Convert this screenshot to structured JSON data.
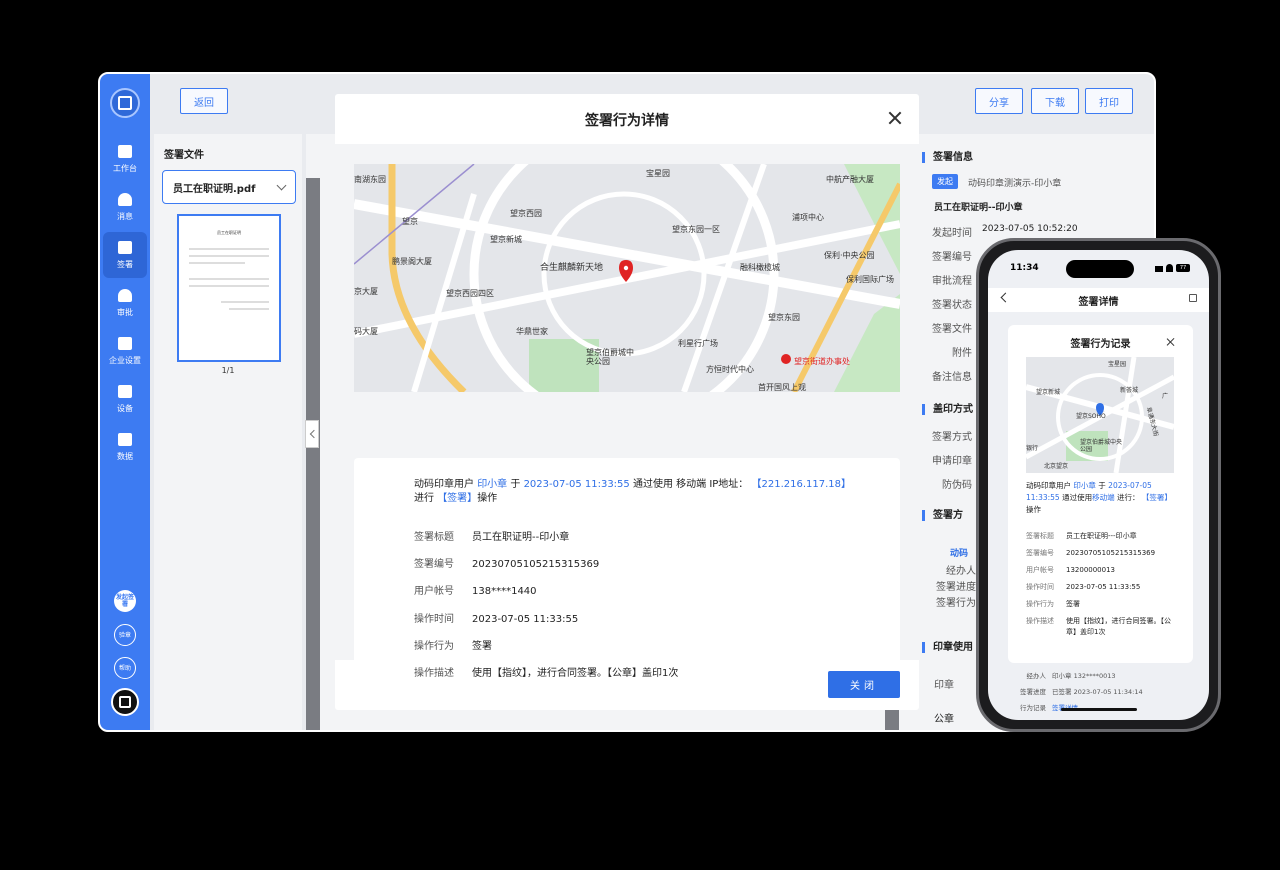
{
  "sidebar": {
    "items": [
      {
        "label": "工作台"
      },
      {
        "label": "消息"
      },
      {
        "label": "签署"
      },
      {
        "label": "审批"
      },
      {
        "label": "企业设置"
      },
      {
        "label": "设备"
      },
      {
        "label": "数据"
      }
    ],
    "bottom": [
      {
        "label": "发起签署"
      },
      {
        "label": "验章"
      },
      {
        "label": "帮助"
      }
    ]
  },
  "toolbar": {
    "back": "返回",
    "share": "分享",
    "download": "下载",
    "print": "打印"
  },
  "left_panel": {
    "title": "签署文件",
    "file_select": "员工在职证明.pdf",
    "page": "1/1",
    "thumb_title": "员工在职证明"
  },
  "right_panel": {
    "section_sign_info": "签署信息",
    "tag_initiate": "发起",
    "initiator_line": "动码印章测演示-印小章",
    "doc_title": "员工在职证明--印小章",
    "rows": [
      {
        "label": "发起时间",
        "value": "2023-07-05 10:52:20"
      },
      {
        "label": "签署编号",
        "value": ""
      },
      {
        "label": "审批流程",
        "value": ""
      },
      {
        "label": "签署状态",
        "value": ""
      },
      {
        "label": "签署文件",
        "value": ""
      },
      {
        "label": "附件",
        "value": ""
      },
      {
        "label": "备注信息",
        "value": ""
      }
    ],
    "section_seal_method": "盖印方式",
    "seal_rows": [
      {
        "label": "签署方式"
      },
      {
        "label": "申请印章"
      },
      {
        "label": "防伪码"
      }
    ],
    "section_signer": "签署方",
    "signer_name": "动码",
    "signer_rows": [
      {
        "label": "经办人"
      },
      {
        "label": "签署进度"
      },
      {
        "label": "签署行为"
      }
    ],
    "section_seal_use": "印章使用",
    "seal_use_rows": [
      {
        "label": "印章"
      },
      {
        "label": "公章"
      }
    ]
  },
  "modal": {
    "title": "签署行为详情",
    "map_labels": [
      "宝星园",
      "望京西园",
      "中航产融大厦",
      "望京",
      "望京东园一区",
      "浦项中心",
      "望京新城",
      "合生麒麟新天地",
      "融科橄榄城",
      "保利·中央公园",
      "鹏景阁大厦",
      "保利国际广场",
      "望京西园四区",
      "华鼎世家",
      "望京东园",
      "望京伯爵城中央公园",
      "利星行广场",
      "望京街道办事处",
      "方恒时代中心",
      "首开国风上观",
      "南湖东园",
      "京大厦",
      "码大厦"
    ],
    "desc_parts": {
      "p1": "动码印章用户",
      "user": "印小章",
      "p2": "于",
      "time": "2023-07-05 11:33:55",
      "p3": "通过使用 移动端 IP地址：",
      "ip": "【221.216.117.18】",
      "p4": "进行",
      "action": "【签署】",
      "p5": "操作"
    },
    "rows": [
      {
        "label": "签署标题",
        "value": "员工在职证明--印小章"
      },
      {
        "label": "签署编号",
        "value": "20230705105215315369"
      },
      {
        "label": "用户帐号",
        "value": "138****1440"
      },
      {
        "label": "操作时间",
        "value": "2023-07-05 11:33:55"
      },
      {
        "label": "操作行为",
        "value": "签署"
      },
      {
        "label": "操作描述",
        "value": "使用【指纹】，进行合同签署。【公章】盖印1次"
      }
    ],
    "close_btn": "关闭"
  },
  "phone": {
    "time": "11:34",
    "battery": "77",
    "nav_title": "签署详情",
    "modal_title": "签署行为记录",
    "map_labels": [
      "宝星园",
      "望京新城",
      "新荟城",
      "望京SOHO",
      "望京伯爵城中央公园",
      "北京望京",
      "银行",
      "阜通东大街",
      "广"
    ],
    "desc_parts": {
      "p1": "动码印章用户",
      "user": "印小章",
      "p2": "于",
      "time": "2023-07-05 11:33:55",
      "p3": "通过使用",
      "device": "移动端",
      "p4": "进行：",
      "action": "【签署】",
      "p5": "操作"
    },
    "rows": [
      {
        "label": "签署标题",
        "value": "员工在职证明---印小章"
      },
      {
        "label": "签署编号",
        "value": "20230705105215315369"
      },
      {
        "label": "用户帐号",
        "value": "13200000013"
      },
      {
        "label": "操作时间",
        "value": "2023-07-05 11:33:55"
      },
      {
        "label": "操作行为",
        "value": "签署"
      },
      {
        "label": "操作描述",
        "value": "使用【指纹】，进行合同签署。【公章】盖印1次"
      }
    ],
    "bg_rows": [
      {
        "label": "经办人",
        "value": "印小章 132****0013"
      },
      {
        "label": "签署进度",
        "value": "已签署 2023-07-05 11:34:14"
      },
      {
        "label": "行为记录",
        "value": "签署详情"
      }
    ]
  },
  "colors": {
    "primary": "#3d7bf2",
    "link": "#2f6fe6",
    "marker": "#e02424"
  }
}
